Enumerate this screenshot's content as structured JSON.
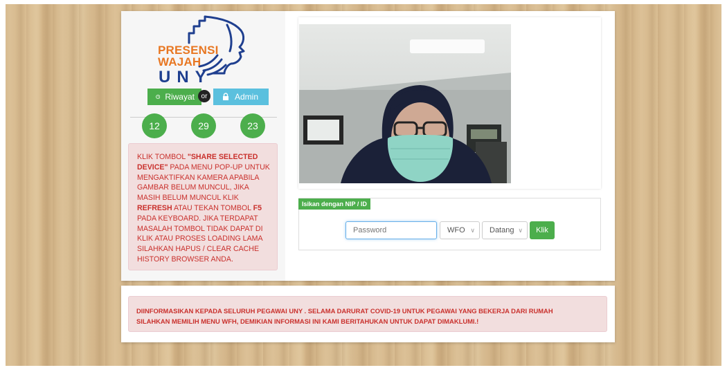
{
  "logo": {
    "line1": "PRESENSI",
    "line2": "WAJAH",
    "line3": "UNY"
  },
  "nav": {
    "riwayat_label": "Riwayat",
    "or_label": "or",
    "admin_label": "Admin",
    "riwayat_icon": "clock-icon",
    "admin_icon": "lock-icon"
  },
  "clock": {
    "hours": "12",
    "minutes": "29",
    "seconds": "23"
  },
  "left_notice": {
    "p1": "KLIK TOMBOL ",
    "p2": "\"SHARE SELECTED DEVICE\"",
    "p3": " PADA MENU POP-UP UNTUK MENGAKTIFKAN KAMERA APABILA GAMBAR BELUM MUNCUL, JIKA MASIH BELUM MUNCUL KLIK ",
    "p4": "REFRESH",
    "p5": " ATAU TEKAN TOMBOL ",
    "p6": "F5",
    "p7": " PADA KEYBOARD. JIKA TERDAPAT MASALAH TOMBOL TIDAK DAPAT DI KLIK ATAU PROSES LOADING LAMA SILAHKAN HAPUS / CLEAR CACHE HISTORY BROWSER ANDA."
  },
  "form": {
    "title": "Isikan dengan NIP / ID",
    "password_placeholder": "Password",
    "mode_selected": "WFO",
    "type_selected": "Datang",
    "submit_label": "Klik"
  },
  "bottom_notice": {
    "line1": "DIINFORMASIKAN KEPADA SELURUH PEGAWAI UNY . SELAMA DARURAT COVID-19 UNTUK PEGAWAI YANG BEKERJA DARI RUMAH",
    "line2": "SILAHKAN MEMILIH MENU WFH, DEMIKIAN INFORMASI INI KAMI BERITAHUKAN UNTUK DAPAT DIMAKLUMI.!"
  },
  "colors": {
    "green": "#4cae4c",
    "blue": "#5bc0de",
    "alert_bg": "#f2dede",
    "alert_text": "#c9302c",
    "logo_orange": "#e87722",
    "logo_blue": "#1f3f8f"
  }
}
